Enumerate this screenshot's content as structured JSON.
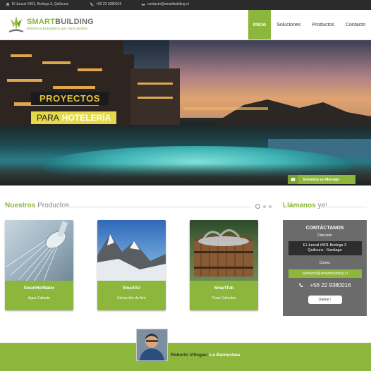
{
  "topbar": {
    "address": "El Juncal #901, Bodega 3, Quilicura.",
    "phone": "+56 22 9380016",
    "email": "contacto@smartbuilding.cl"
  },
  "logo": {
    "title_part1": "SMART",
    "title_part2": "BUILDING",
    "tagline": "Eficiencia Energética que hace sentido"
  },
  "nav": {
    "items": [
      {
        "label": "Inicio",
        "active": true
      },
      {
        "label": "Soluciones",
        "active": false
      },
      {
        "label": "Productos",
        "active": false
      },
      {
        "label": "Contacto",
        "active": false
      }
    ]
  },
  "hero": {
    "line1": "PROYECTOS",
    "line2_prefix": "PARA",
    "line2_bold": "HOTELERÍA",
    "message_button": "Envíanos un Mensaje"
  },
  "products": {
    "title_accent": "Nuestros",
    "title_rest": "Productos",
    "cards": [
      {
        "title": "SmartHotWater",
        "subtitle": "Agua Caliente"
      },
      {
        "title": "SmartAir",
        "subtitle": "Extracción de Aire"
      },
      {
        "title": "SmartTub",
        "subtitle": "Tinas Calientes"
      }
    ]
  },
  "contact": {
    "title_accent": "Llámanos",
    "title_rest": "ya!",
    "heading": "CONTÁCTANOS",
    "address_label": "Dirección",
    "address_line1": "El Juncal #901 Bodega 3",
    "address_line2": "Quilicura - Santiago",
    "email_label": "Correo",
    "email": "contacto@smartbuilding.cl",
    "phone": "+56 22 9380016",
    "call_button": "Llamar !"
  },
  "testimonial": {
    "name": "Roberto Villegas:",
    "place": "Lo Barnechea"
  },
  "colors": {
    "accent": "#8cb63c",
    "topbar": "#2b2b2b",
    "contact_panel": "#6b6b6b"
  }
}
